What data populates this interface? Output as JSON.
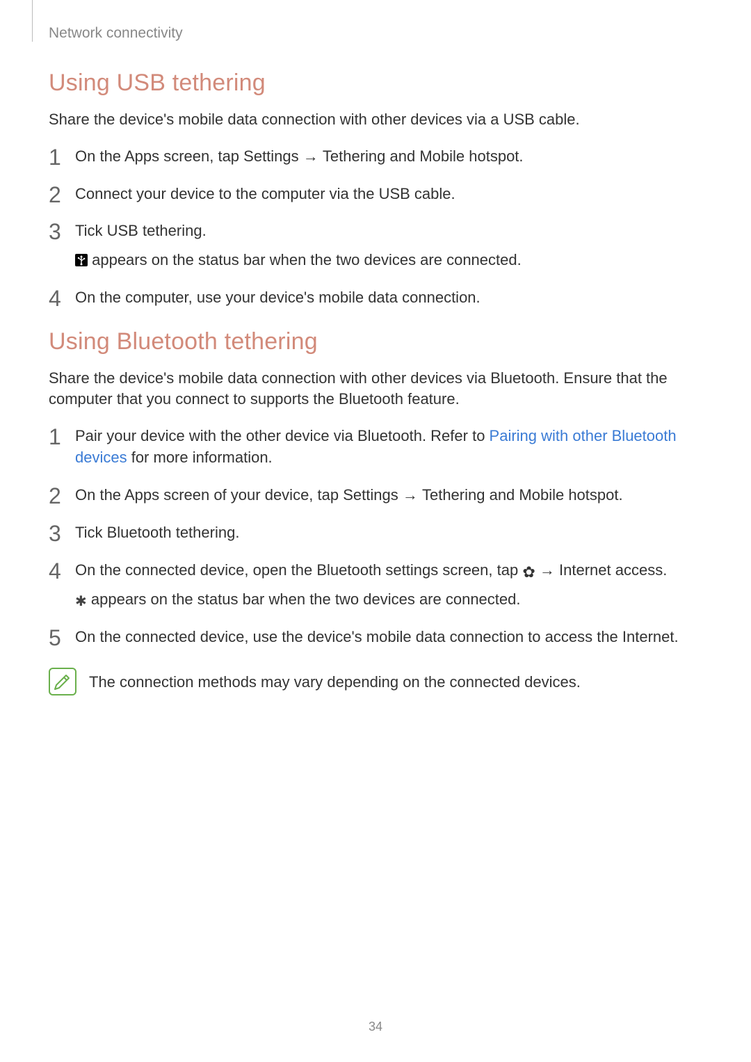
{
  "breadcrumb": "Network connectivity",
  "section_usb": {
    "title": "Using USB tethering",
    "intro": "Share the device's mobile data connection with other devices via a USB cable.",
    "steps": {
      "s1_a": "On the Apps screen, tap ",
      "s1_b": "Settings",
      "s1_c": " → ",
      "s1_d": "Tethering and Mobile hotspot",
      "s1_e": ".",
      "s2": "Connect your device to the computer via the USB cable.",
      "s3_a": "Tick ",
      "s3_b": "USB tethering",
      "s3_c": ".",
      "s3_sub": " appears on the status bar when the two devices are connected.",
      "s4": "On the computer, use your device's mobile data connection."
    }
  },
  "section_bt": {
    "title": "Using Bluetooth tethering",
    "intro": "Share the device's mobile data connection with other devices via Bluetooth. Ensure that the computer that you connect to supports the Bluetooth feature.",
    "steps": {
      "s1_a": "Pair your device with the other device via Bluetooth. Refer to ",
      "s1_link": "Pairing with other Bluetooth devices",
      "s1_c": " for more information.",
      "s2_a": "On the Apps screen of your device, tap ",
      "s2_b": "Settings",
      "s2_c": " → ",
      "s2_d": "Tethering and Mobile hotspot",
      "s2_e": ".",
      "s3_a": "Tick ",
      "s3_b": "Bluetooth tethering",
      "s3_c": ".",
      "s4_a": "On the connected device, open the Bluetooth settings screen, tap ",
      "s4_b": " → ",
      "s4_c": "Internet access",
      "s4_d": ".",
      "s4_sub": " appears on the status bar when the two devices are connected.",
      "s5": "On the connected device, use the device's mobile data connection to access the Internet."
    },
    "note": "The connection methods may vary depending on the connected devices."
  },
  "page_number": "34"
}
